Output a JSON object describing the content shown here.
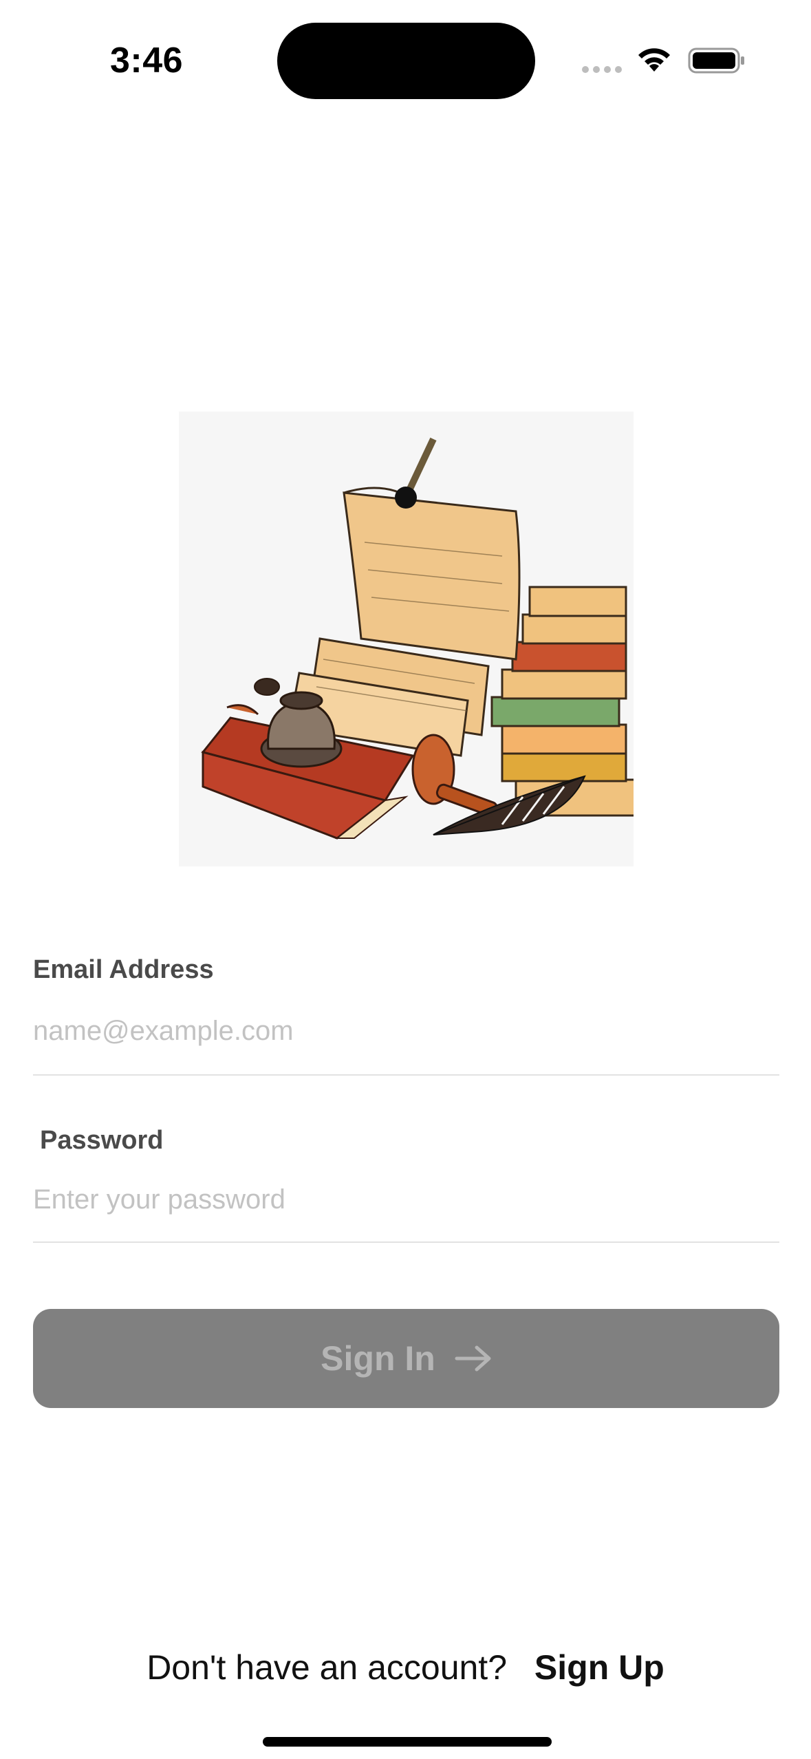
{
  "status_bar": {
    "time": "3:46"
  },
  "form": {
    "email_label": "Email Address",
    "email_placeholder": "name@example.com",
    "email_value": "",
    "password_label": "Password",
    "password_placeholder": "Enter your password",
    "password_value": ""
  },
  "actions": {
    "sign_in_label": "Sign In",
    "sign_in_icon": "arrow-right-icon"
  },
  "footer": {
    "prompt": "Don't have an account?",
    "sign_up_label": "Sign Up"
  },
  "hero": {
    "image": "books-scroll-quill-illustration"
  },
  "colors": {
    "button_disabled_bg": "#808080",
    "button_disabled_text": "#b5b5b5",
    "label_text": "#4a4a4a",
    "placeholder_text": "#c2c2c2",
    "divider": "#e2e2e2"
  }
}
